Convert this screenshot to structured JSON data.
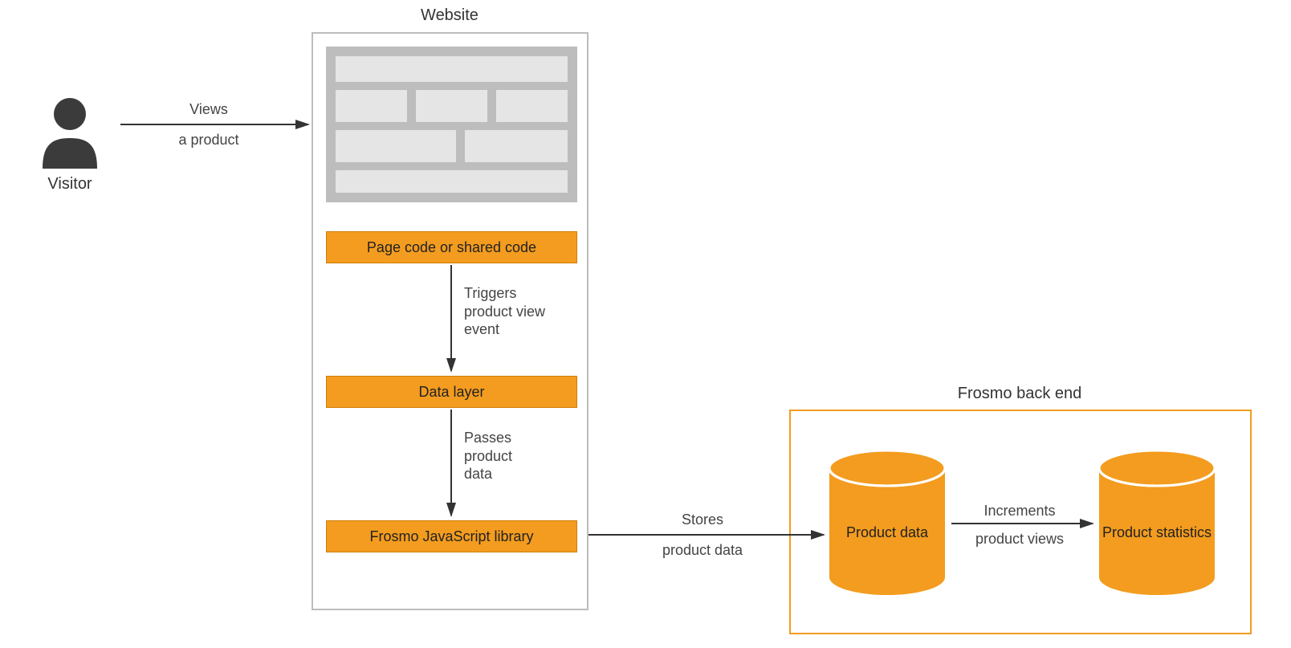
{
  "visitor": {
    "label": "Visitor"
  },
  "website": {
    "label": "Website"
  },
  "backend": {
    "label": "Frosmo back end"
  },
  "boxes": {
    "page_code": "Page code or shared code",
    "data_layer": "Data layer",
    "js_library": "Frosmo JavaScript library"
  },
  "arrows": {
    "views": {
      "top": "Views",
      "bottom": "a product"
    },
    "triggers": "Triggers\nproduct view\nevent",
    "passes": "Passes\nproduct\ndata",
    "stores": {
      "top": "Stores",
      "bottom": "product data"
    },
    "increments": {
      "top": "Increments",
      "bottom": "product views"
    }
  },
  "cylinders": {
    "product_data": "Product\ndata",
    "product_stats": "Product\nstatistics"
  }
}
